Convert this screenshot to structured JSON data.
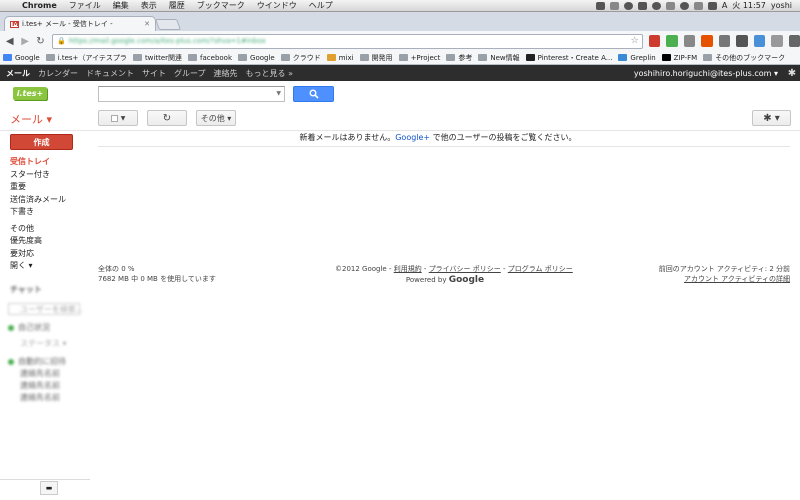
{
  "menubar": {
    "items": [
      "Chrome",
      "ファイル",
      "編集",
      "表示",
      "履歴",
      "ブックマーク",
      "ウインドウ",
      "ヘルプ"
    ],
    "clock": "火 11:57",
    "user": "yoshi",
    "input_method": "A"
  },
  "tab": {
    "title": "i.tes+ メール - 受信トレイ -"
  },
  "omnibox": {
    "url": "https://mail.google.com/a/ites-plus.com/?shva=1#inbox"
  },
  "bookmarks": [
    {
      "label": "Google",
      "icon": "google-icon"
    },
    {
      "label": "i.tes+（アイテスプラ",
      "icon": "folder-icon"
    },
    {
      "label": "twitter関連",
      "icon": "folder-icon"
    },
    {
      "label": "facebook",
      "icon": "folder-icon"
    },
    {
      "label": "Google",
      "icon": "folder-icon"
    },
    {
      "label": "クラウド",
      "icon": "folder-icon"
    },
    {
      "label": "mixi",
      "icon": "mixi-icon"
    },
    {
      "label": "開発用",
      "icon": "folder-icon"
    },
    {
      "label": "+Project",
      "icon": "folder-icon"
    },
    {
      "label": "参考",
      "icon": "folder-icon"
    },
    {
      "label": "New情報",
      "icon": "folder-icon"
    },
    {
      "label": "Pinterest・Create A...",
      "icon": "pinterest-icon"
    },
    {
      "label": "Greplin",
      "icon": "greplin-icon"
    },
    {
      "label": "ZIP-FM",
      "icon": "zip-icon"
    }
  ],
  "bookmarks_other": "その他のブックマーク",
  "gbar": {
    "items": [
      "メール",
      "カレンダー",
      "ドキュメント",
      "サイト",
      "グループ",
      "連絡先",
      "もっと見る »"
    ],
    "user_email": "yoshihiro.horiguchi@ites-plus.com ▾"
  },
  "logo_text": "i.tes+",
  "search": {
    "placeholder": "",
    "button_icon": "search-icon"
  },
  "mail_menu": "メール ▾",
  "toolbar": {
    "more_label": "その他 ▾"
  },
  "compose_label": "作成",
  "nav": {
    "primary": [
      "受信トレイ",
      "スター付き",
      "重要",
      "送信済みメール",
      "下書き"
    ],
    "secondary": [
      "その他",
      "優先度高",
      "要対応",
      "開く ▾"
    ]
  },
  "blurred": {
    "chat_title": "チャット",
    "search_people": "ユーザーを検索...",
    "contact1": "自己状況",
    "status_label": "ステータス",
    "group_label": "自動的に招待",
    "contact2": "連絡先名前",
    "contact3": "連絡先名前",
    "contact4": "連絡先名前"
  },
  "main": {
    "empty_before": "新着メールはありません。",
    "empty_link": "Google+",
    "empty_after": " で他のユーザーの投稿をご覧ください。"
  },
  "footer": {
    "usage": "全体の 0 %",
    "usage_detail": "7682 MB 中 0 MB を使用しています",
    "copyright": "©2012 Google - ",
    "terms": "利用規約",
    "sep1": " - ",
    "privacy": "プライバシー ポリシー",
    "sep2": " - ",
    "program": "プログラム ポリシー",
    "powered": "Powered by ",
    "powered_brand": "Google",
    "last_activity": "前回のアカウント アクティビティ: 2 分前",
    "activity_details": "アカウント アクティビティの詳細"
  },
  "colors": {
    "compose": "#d14836",
    "search_button": "#4d90fe",
    "gbar": "#2d2d2d",
    "selected_nav": "#dd4b39",
    "logo": "#8bc53f"
  }
}
